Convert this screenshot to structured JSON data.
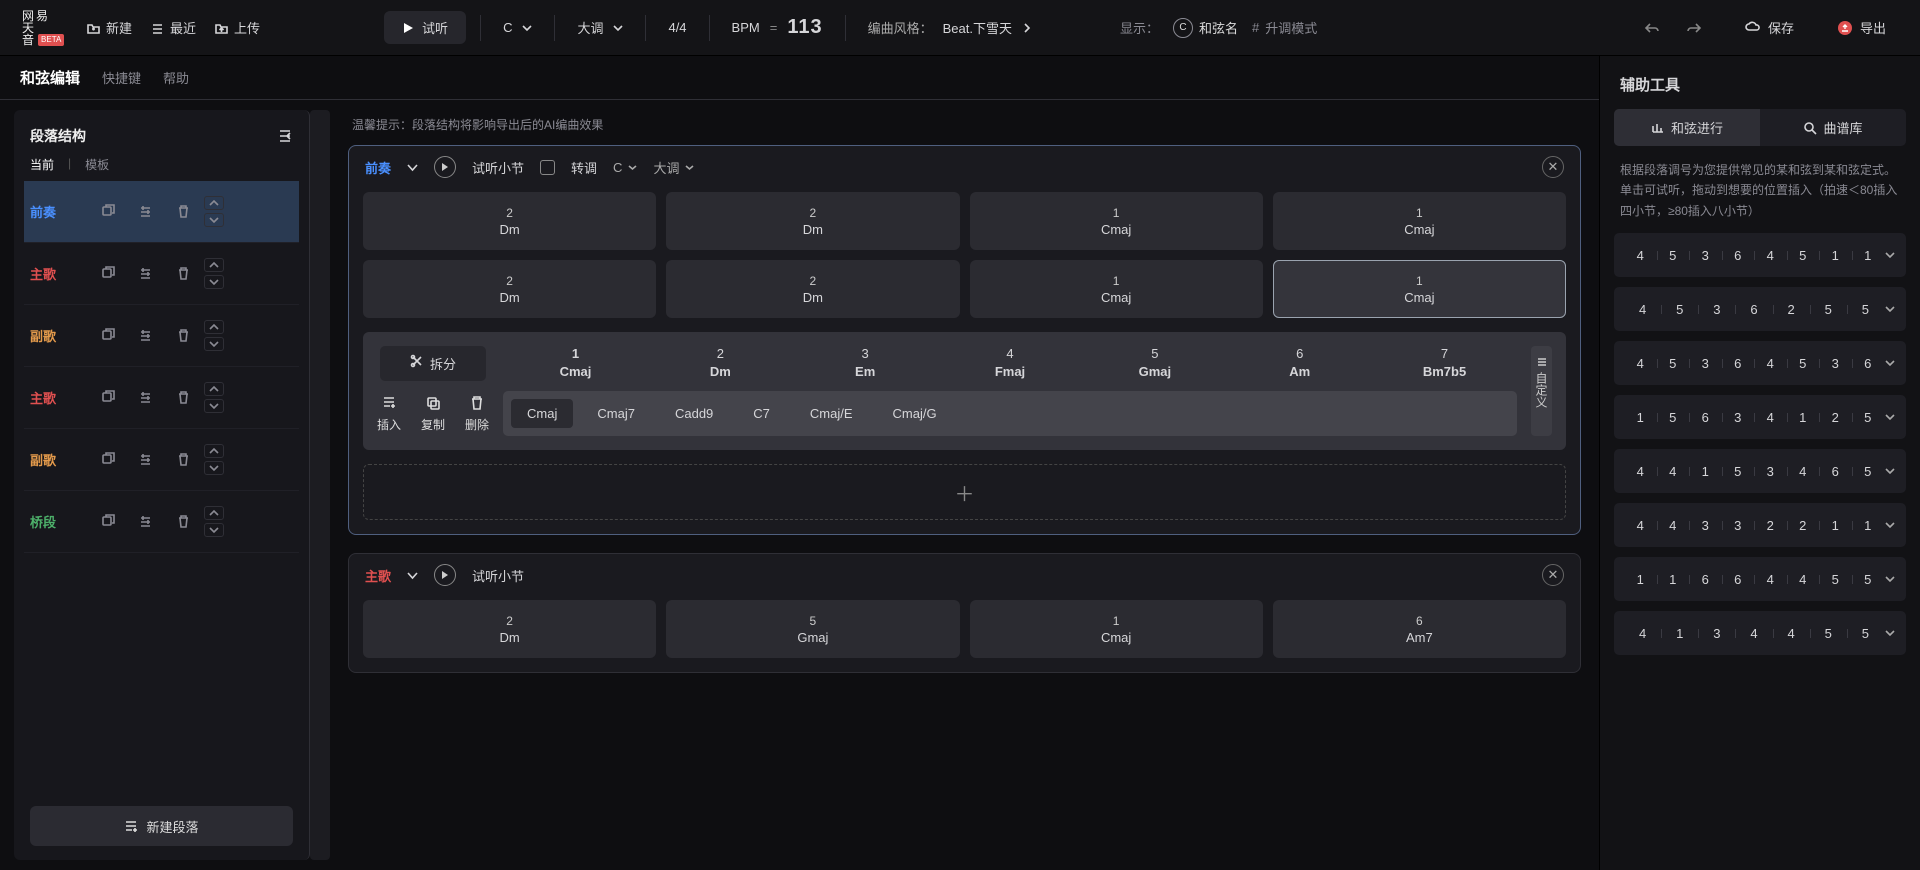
{
  "top": {
    "logo_l1": "网易",
    "logo_l2": "天音",
    "logo_tag": "BETA",
    "new": "新建",
    "recent": "最近",
    "upload": "上传",
    "play": "试听",
    "key": "C",
    "mode": "大调",
    "timesig": "4/4",
    "bpm_label": "BPM",
    "bpm_eq": "=",
    "bpm": "113",
    "style_label": "编曲风格：",
    "style_value": "Beat.下雪天",
    "display_label": "显示：",
    "disp_chord": "和弦名",
    "disp_sharp": "升调模式",
    "save": "保存",
    "export": "导出"
  },
  "leftTabs": {
    "title": "和弦编辑",
    "shortcut": "快捷键",
    "help": "帮助"
  },
  "structure": {
    "title": "段落结构",
    "tab_current": "当前",
    "tab_template": "模板",
    "new": "新建段落",
    "items": [
      {
        "name": "前奏",
        "cls": "c-blue",
        "active": true
      },
      {
        "name": "主歌",
        "cls": "c-red"
      },
      {
        "name": "副歌",
        "cls": "c-orange"
      },
      {
        "name": "主歌",
        "cls": "c-red"
      },
      {
        "name": "副歌",
        "cls": "c-orange"
      },
      {
        "name": "桥段",
        "cls": "c-green"
      }
    ]
  },
  "editor": {
    "hint": "温馨提示：段落结构将影响导出后的AI编曲效果",
    "preview_bar": "试听小节",
    "transpose": "转调",
    "key": "C",
    "mode": "大调",
    "sections": [
      {
        "title": "前奏",
        "cls": "c-blue",
        "active": true,
        "cells": [
          {
            "deg": "2",
            "name": "Dm"
          },
          {
            "deg": "2",
            "name": "Dm"
          },
          {
            "deg": "1",
            "name": "Cmaj"
          },
          {
            "deg": "1",
            "name": "Cmaj"
          },
          {
            "deg": "2",
            "name": "Dm"
          },
          {
            "deg": "2",
            "name": "Dm"
          },
          {
            "deg": "1",
            "name": "Cmaj"
          },
          {
            "deg": "1",
            "name": "Cmaj",
            "sel": true
          }
        ]
      },
      {
        "title": "主歌",
        "cls": "c-red",
        "cells": [
          {
            "deg": "2",
            "name": "Dm"
          },
          {
            "deg": "5",
            "name": "Gmaj"
          },
          {
            "deg": "1",
            "name": "Cmaj"
          },
          {
            "deg": "6",
            "name": "Am7"
          }
        ]
      }
    ],
    "chooser": {
      "split": "拆分",
      "insert": "插入",
      "copy": "复制",
      "delete": "删除",
      "custom": "自定义",
      "degrees": [
        {
          "n": "1",
          "c": "Cmaj",
          "sel": true
        },
        {
          "n": "2",
          "c": "Dm"
        },
        {
          "n": "3",
          "c": "Em"
        },
        {
          "n": "4",
          "c": "Fmaj"
        },
        {
          "n": "5",
          "c": "Gmaj"
        },
        {
          "n": "6",
          "c": "Am"
        },
        {
          "n": "7",
          "c": "Bm7b5"
        }
      ],
      "variants": [
        {
          "v": "Cmaj",
          "sel": true
        },
        {
          "v": "Cmaj7"
        },
        {
          "v": "Cadd9"
        },
        {
          "v": "C7"
        },
        {
          "v": "Cmaj/E"
        },
        {
          "v": "Cmaj/G"
        }
      ]
    }
  },
  "right": {
    "title": "辅助工具",
    "tab_prog": "和弦进行",
    "tab_lib": "曲谱库",
    "desc": "根据段落调号为您提供常见的某和弦到某和弦定式。单击可试听，拖动到想要的位置插入（拍速＜80插入四小节，≥80插入八小节）",
    "progressions": [
      [
        "4",
        "5",
        "3",
        "6",
        "4",
        "5",
        "1",
        "1"
      ],
      [
        "4",
        "5",
        "3",
        "6",
        "2",
        "5",
        "5"
      ],
      [
        "4",
        "5",
        "3",
        "6",
        "4",
        "5",
        "3",
        "6"
      ],
      [
        "1",
        "5",
        "6",
        "3",
        "4",
        "1",
        "2",
        "5"
      ],
      [
        "4",
        "4",
        "1",
        "5",
        "3",
        "4",
        "6",
        "5"
      ],
      [
        "4",
        "4",
        "3",
        "3",
        "2",
        "2",
        "1",
        "1"
      ],
      [
        "1",
        "1",
        "6",
        "6",
        "4",
        "4",
        "5",
        "5"
      ],
      [
        "4",
        "1",
        "3",
        "4",
        "4",
        "5",
        "5"
      ]
    ]
  }
}
